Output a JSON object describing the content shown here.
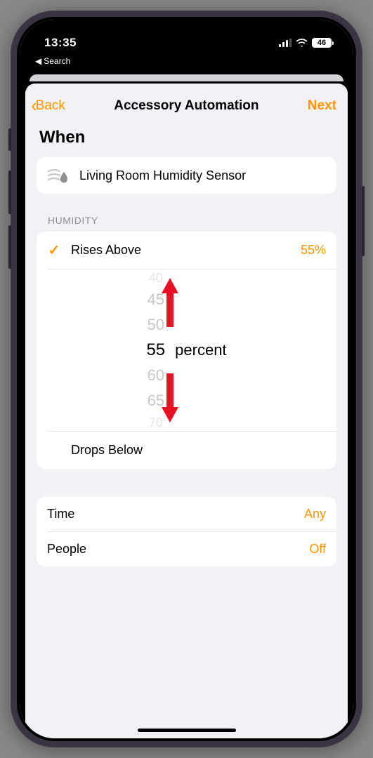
{
  "status": {
    "time": "13:35",
    "battery": "46",
    "back_app": "Search"
  },
  "nav": {
    "back": "Back",
    "title": "Accessory Automation",
    "next": "Next"
  },
  "section": {
    "when": "When"
  },
  "sensor": {
    "name": "Living Room Humidity Sensor"
  },
  "humidity": {
    "group_label": "HUMIDITY",
    "rises_label": "Rises Above",
    "rises_value": "55%",
    "drops_label": "Drops Below",
    "picker_unit": "percent",
    "picker_values": [
      "40",
      "45",
      "50",
      "55",
      "60",
      "65",
      "70"
    ],
    "picker_selected": "55"
  },
  "settings": {
    "time_label": "Time",
    "time_value": "Any",
    "people_label": "People",
    "people_value": "Off"
  }
}
